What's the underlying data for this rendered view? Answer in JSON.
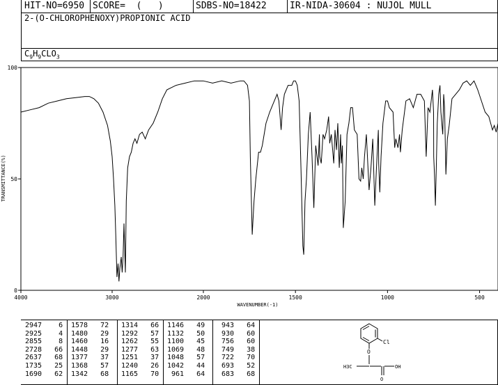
{
  "header": {
    "hit_no": "HIT-NO=6950",
    "score": "SCORE=  (   )",
    "sdbs_no": "SDBS-NO=18422",
    "ir_info": "IR-NIDA-30604 : NUJOL MULL",
    "compound_name": "2-(O-CHLOROPHENOXY)PROPIONIC ACID",
    "formula": "C9H9CLO3"
  },
  "chart_data": {
    "type": "line",
    "xlabel": "WAVENUMBER(-1)",
    "ylabel": "TRANSMITTANCE(%)",
    "xlim": [
      4000,
      400
    ],
    "ylim": [
      0,
      100
    ],
    "x_ticks": [
      4000,
      3000,
      2000,
      1500,
      1000,
      500
    ],
    "y_ticks": [
      0,
      50,
      100
    ],
    "grid": false,
    "series": [
      {
        "x": [
          4000,
          3900,
          3800,
          3700,
          3600,
          3500,
          3400,
          3300,
          3250,
          3200,
          3150,
          3100,
          3050,
          3020,
          3000,
          2985,
          2970,
          2960,
          2947,
          2935,
          2925,
          2915,
          2900,
          2890,
          2880,
          2870,
          2855,
          2845,
          2830,
          2810,
          2790,
          2770,
          2750,
          2728,
          2700,
          2670,
          2637,
          2600,
          2550,
          2500,
          2450,
          2400,
          2300,
          2200,
          2100,
          2000,
          1950,
          1900,
          1850,
          1800,
          1780,
          1760,
          1750,
          1745,
          1735,
          1725,
          1715,
          1700,
          1690,
          1680,
          1660,
          1640,
          1620,
          1600,
          1590,
          1578,
          1570,
          1560,
          1540,
          1520,
          1510,
          1500,
          1490,
          1480,
          1470,
          1460,
          1455,
          1448,
          1440,
          1430,
          1420,
          1410,
          1400,
          1390,
          1377,
          1370,
          1368,
          1360,
          1350,
          1342,
          1330,
          1320,
          1314,
          1305,
          1292,
          1285,
          1277,
          1270,
          1262,
          1255,
          1251,
          1245,
          1240,
          1230,
          1220,
          1210,
          1200,
          1190,
          1180,
          1165,
          1155,
          1146,
          1140,
          1132,
          1125,
          1115,
          1100,
          1090,
          1080,
          1069,
          1060,
          1050,
          1048,
          1042,
          1035,
          1025,
          1010,
          1000,
          990,
          970,
          961,
          955,
          943,
          935,
          930,
          920,
          900,
          880,
          860,
          840,
          820,
          800,
          790,
          780,
          770,
          756,
          750,
          749,
          745,
          740,
          735,
          730,
          722,
          715,
          710,
          700,
          695,
          690,
          683,
          675,
          665,
          650,
          630,
          610,
          590,
          570,
          550,
          530,
          510,
          490,
          470,
          450,
          430,
          420,
          410,
          400
        ],
        "y": [
          80,
          81,
          82,
          84,
          85,
          86,
          86.5,
          87,
          87,
          86,
          84,
          80,
          74,
          67,
          60,
          50,
          38,
          25,
          6,
          12,
          4,
          10,
          15,
          8,
          15,
          30,
          8,
          40,
          55,
          60,
          62,
          66,
          68,
          66,
          70,
          71,
          68,
          72,
          75,
          80,
          86,
          90,
          92,
          93,
          94,
          94,
          93,
          94,
          93,
          94,
          94,
          92,
          85,
          60,
          25,
          40,
          50,
          62,
          62,
          65,
          75,
          80,
          84,
          88,
          85,
          72,
          82,
          88,
          92,
          92,
          94,
          94,
          92,
          85,
          55,
          20,
          16,
          40,
          50,
          70,
          80,
          60,
          37,
          65,
          56,
          70,
          60,
          57,
          70,
          68,
          72,
          78,
          66,
          70,
          57,
          72,
          63,
          75,
          55,
          70,
          57,
          65,
          28,
          40,
          70,
          75,
          82,
          82,
          72,
          70,
          50,
          49,
          55,
          50,
          60,
          70,
          45,
          55,
          68,
          38,
          55,
          72,
          57,
          44,
          60,
          75,
          85,
          85,
          82,
          80,
          64,
          68,
          64,
          70,
          62,
          72,
          85,
          86,
          82,
          88,
          88,
          85,
          60,
          82,
          80,
          90,
          80,
          60,
          52,
          38,
          55,
          75,
          88,
          92,
          80,
          70,
          88,
          82,
          52,
          68,
          74,
          86,
          88,
          90,
          93,
          94,
          92,
          94,
          90,
          85,
          80,
          78,
          72,
          74,
          71,
          75
        ]
      }
    ],
    "peak_table": [
      [
        "2947",
        "6"
      ],
      [
        "2925",
        "4"
      ],
      [
        "2855",
        "8"
      ],
      [
        "2728",
        "66"
      ],
      [
        "2637",
        "68"
      ],
      [
        "1735",
        "25"
      ],
      [
        "1690",
        "62"
      ],
      [
        "1578",
        "72"
      ],
      [
        "1480",
        "29"
      ],
      [
        "1460",
        "16"
      ],
      [
        "1448",
        "29"
      ],
      [
        "1377",
        "37"
      ],
      [
        "1368",
        "57"
      ],
      [
        "1342",
        "68"
      ],
      [
        "1314",
        "66"
      ],
      [
        "1292",
        "57"
      ],
      [
        "1262",
        "55"
      ],
      [
        "1277",
        "63"
      ],
      [
        "1251",
        "37"
      ],
      [
        "1240",
        "26"
      ],
      [
        "1165",
        "70"
      ],
      [
        "1146",
        "49"
      ],
      [
        "1132",
        "50"
      ],
      [
        "1100",
        "45"
      ],
      [
        "1069",
        "48"
      ],
      [
        "1048",
        "57"
      ],
      [
        "1042",
        "44"
      ],
      [
        "961",
        "64"
      ],
      [
        "943",
        "64"
      ],
      [
        "930",
        "60"
      ],
      [
        "756",
        "60"
      ],
      [
        "749",
        "38"
      ],
      [
        "722",
        "70"
      ],
      [
        "693",
        "52"
      ],
      [
        "683",
        "68"
      ]
    ]
  },
  "structure": {
    "substituent": "Cl",
    "side_chain_left": "H3C",
    "side_chain_right": "OH",
    "carbonyl_o": "O"
  }
}
